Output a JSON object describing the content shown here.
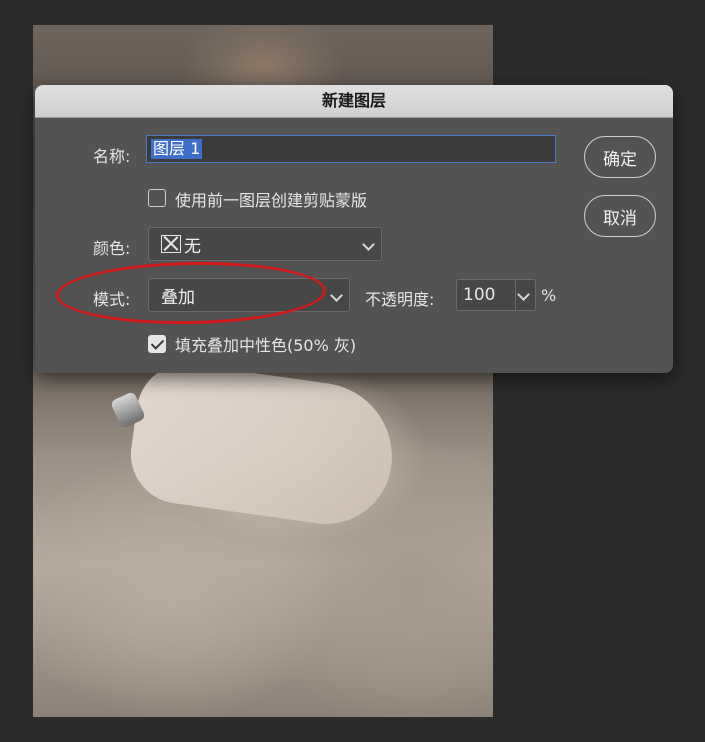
{
  "dialog": {
    "title": "新建图层",
    "name_label": "名称:",
    "name_value": "图层 1",
    "clip_checkbox_label": "使用前一图层创建剪贴蒙版",
    "clip_checkbox_checked": false,
    "color_label": "颜色:",
    "color_value": "无",
    "mode_label": "模式:",
    "mode_value": "叠加",
    "opacity_label": "不透明度:",
    "opacity_value": "100",
    "opacity_unit": "%",
    "fill_checkbox_label": "填充叠加中性色(50% 灰)",
    "fill_checkbox_checked": true,
    "ok_button": "确定",
    "cancel_button": "取消"
  },
  "annotation": {
    "color": "#d31a1a"
  }
}
